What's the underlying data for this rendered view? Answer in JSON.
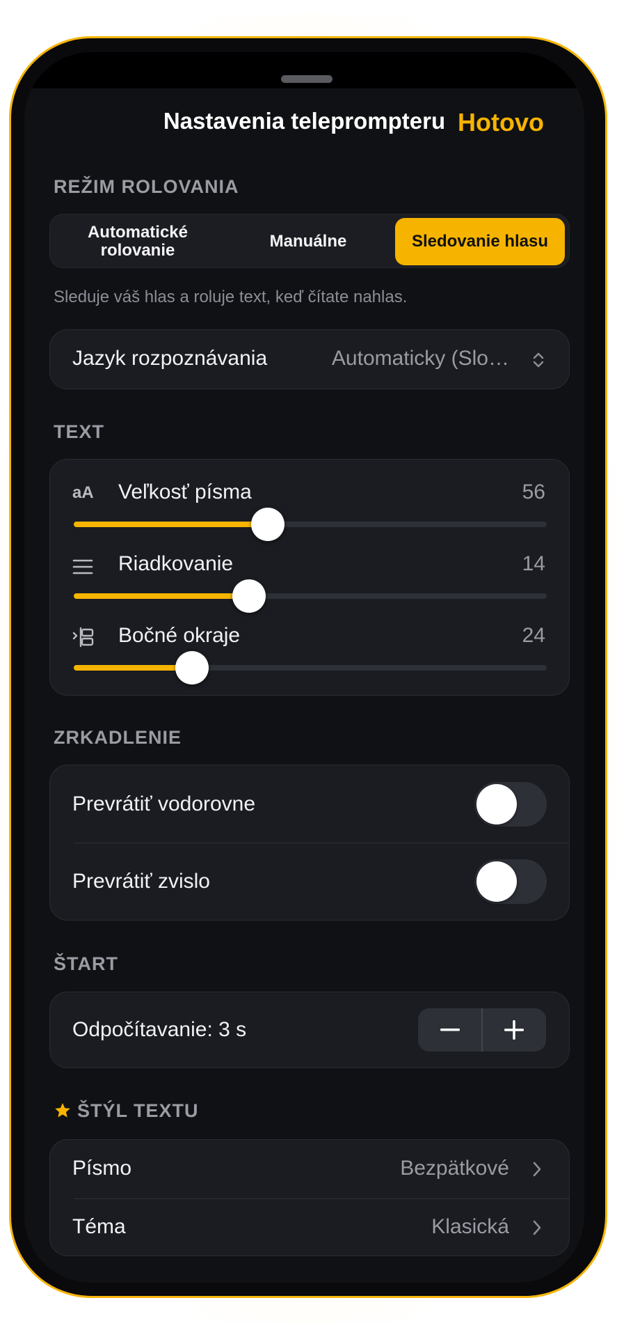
{
  "header": {
    "title": "Nastavenia teleprompteru",
    "done_label": "Hotovo"
  },
  "scroll_mode": {
    "label": "REŽIM ROLOVANIA",
    "options": [
      "Automatické rolovanie",
      "Manuálne",
      "Sledovanie hlasu"
    ],
    "selected": "Sledovanie hlasu",
    "helper": "Sleduje váš hlas a roluje text, keď čítate nahlas.",
    "language_label": "Jazyk rozpoznávania",
    "language_value": "Automaticky (Slo…"
  },
  "text": {
    "label": "TEXT",
    "font_size": {
      "label": "Veľkosť písma",
      "value": "56",
      "fraction": 0.41
    },
    "line_spacing": {
      "label": "Riadkovanie",
      "value": "14",
      "fraction": 0.37
    },
    "margins": {
      "label": "Bočné okraje",
      "value": "24",
      "fraction": 0.25
    },
    "font_size_icon_text": "aA"
  },
  "mirror": {
    "label": "ZRKADLENIE",
    "horizontal": {
      "label": "Prevrátiť vodorovne",
      "on": false
    },
    "vertical": {
      "label": "Prevrátiť zvislo",
      "on": false
    }
  },
  "start": {
    "label": "ŠTART",
    "countdown": "Odpočítavanie: 3 s",
    "minus": "−",
    "plus": "+"
  },
  "text_style": {
    "label": "ŠTÝL TEXTU",
    "font": {
      "label": "Písmo",
      "value": "Bezpätkové"
    },
    "theme": {
      "label": "Téma",
      "value": "Klasická"
    }
  },
  "colors": {
    "accent": "#f6b400",
    "background": "#101114",
    "card": "#1a1c21"
  },
  "icons": [
    "text-size-icon",
    "line-spacing-icon",
    "margins-icon",
    "star-icon",
    "chevron-right-icon",
    "updown-chevron-icon"
  ]
}
